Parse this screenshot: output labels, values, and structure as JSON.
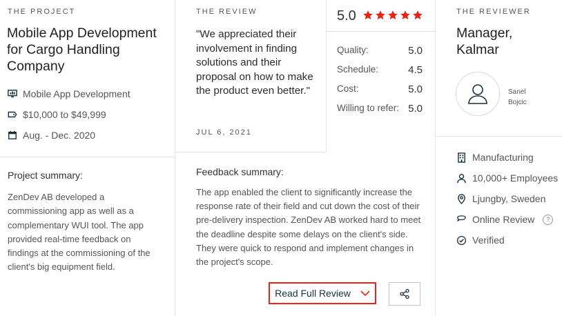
{
  "project": {
    "section_label": "THE PROJECT",
    "title": "Mobile App Development for Cargo Handling Company",
    "service": "Mobile App Development",
    "budget": "$10,000 to $49,999",
    "dates": "Aug. - Dec. 2020",
    "summary_heading": "Project summary:",
    "summary": "ZenDev AB developed a commissioning app as well as a complementary WUI tool. The app provided real-time feedback on findings at the commissioning of the client's big equipment field."
  },
  "review": {
    "section_label": "THE REVIEW",
    "quote": "\"We appreciated their involvement in finding solutions and their proposal on how to make the product even better.\"",
    "date": "JUL 6, 2021",
    "overall_score": "5.0",
    "star_count": 5,
    "ratings": [
      {
        "label": "Quality:",
        "value": "5.0"
      },
      {
        "label": "Schedule:",
        "value": "4.5"
      },
      {
        "label": "Cost:",
        "value": "5.0"
      },
      {
        "label": "Willing to refer:",
        "value": "5.0"
      }
    ],
    "feedback_heading": "Feedback summary:",
    "feedback": "The app enabled the client to significantly increase the response rate of their field and cut down the cost of their pre-delivery inspection. ZenDev AB worked hard to meet the deadline despite some delays on the client's side. They were quick to respond and implement changes in the project's scope.",
    "read_full_label": "Read Full Review"
  },
  "reviewer": {
    "section_label": "THE REVIEWER",
    "title": "Manager, Kalmar",
    "name_line1": "Sanel",
    "name_line2": "Bojcic",
    "industry": "Manufacturing",
    "employees": "10,000+ Employees",
    "location": "Ljungby, Sweden",
    "review_type": "Online Review",
    "help_glyph": "?",
    "verification": "Verified"
  },
  "colors": {
    "accent_red": "#e62415",
    "divider": "#dfe6ea",
    "icon_teal": "#17313b"
  },
  "icons": [
    "monitor-icon",
    "tag-icon",
    "calendar-icon",
    "star-icon",
    "chevron-down-icon",
    "share-icon",
    "user-icon",
    "building-icon",
    "person-icon",
    "location-pin-icon",
    "chat-icon",
    "check-circle-icon"
  ]
}
